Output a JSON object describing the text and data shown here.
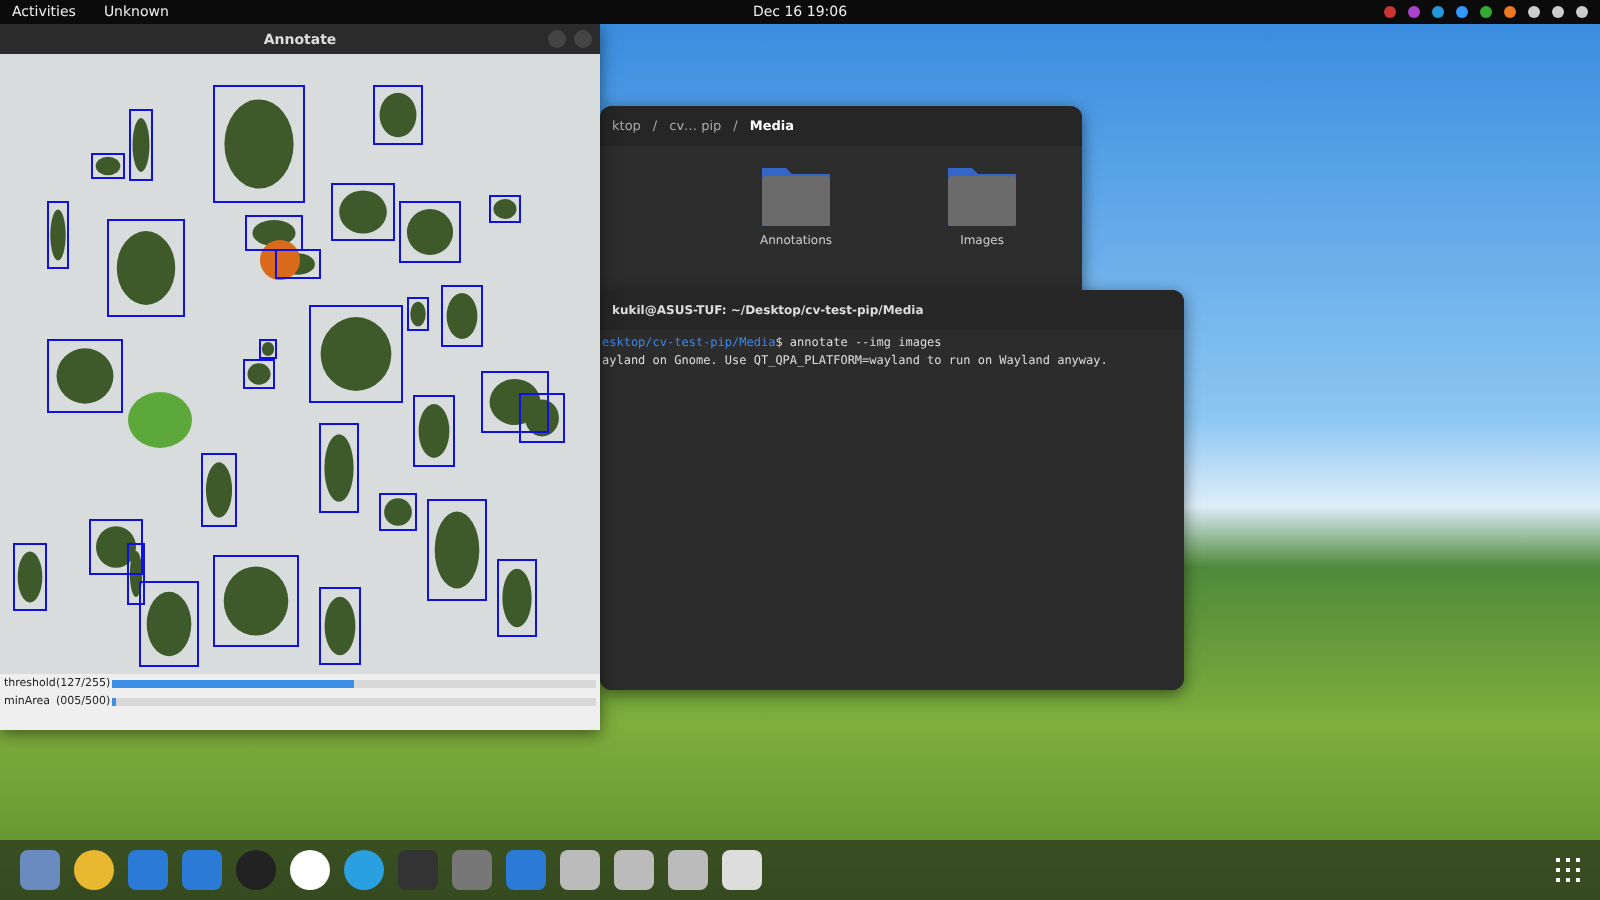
{
  "top_bar": {
    "activities": "Activities",
    "app_name": "Unknown",
    "clock": "Dec 16  19:06"
  },
  "annotate_window": {
    "title": "Annotate",
    "sliders": [
      {
        "label": "threshold",
        "reading": "(127/255)",
        "level": 0.5
      },
      {
        "label": "minArea",
        "reading": "(005/500)",
        "level": 0.01
      }
    ]
  },
  "file_manager": {
    "path": [
      {
        "label": "ktop",
        "selected": false
      },
      {
        "separator": "/",
        "label": "cv… pip",
        "selected": false
      },
      {
        "separator": "/",
        "label": "Media",
        "selected": true
      }
    ],
    "folders": [
      "Annotations",
      "Images"
    ]
  },
  "terminal": {
    "title": "kukil@ASUS-TUF: ~/Desktop/cv-test-pip/Media",
    "lines": [
      {
        "prompt": "esktop/cv-test-pip/Media",
        "command": "$ annotate --img images"
      },
      {
        "output": "ayland on Gnome. Use QT_QPA_PLATFORM=wayland to run on Wayland anyway."
      }
    ]
  }
}
